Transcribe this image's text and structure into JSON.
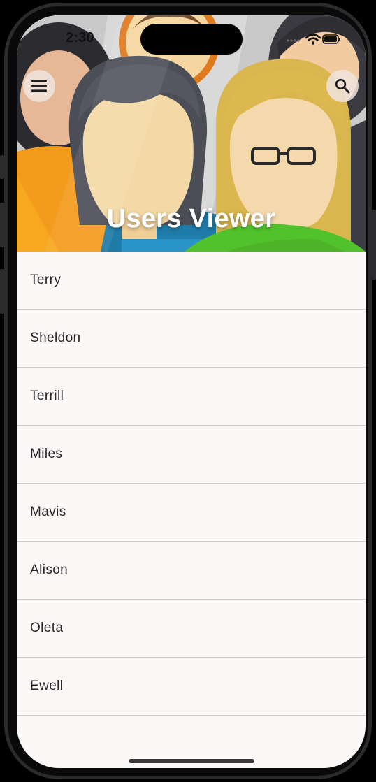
{
  "status_bar": {
    "time": "2:30"
  },
  "app_bar": {
    "title": "Users Viewer",
    "menu_icon": "hamburger-menu-icon",
    "search_icon": "search-icon"
  },
  "users": [
    {
      "name": "Terry"
    },
    {
      "name": "Sheldon"
    },
    {
      "name": "Terrill"
    },
    {
      "name": "Miles"
    },
    {
      "name": "Mavis"
    },
    {
      "name": "Alison"
    },
    {
      "name": "Oleta"
    },
    {
      "name": "Ewell"
    }
  ],
  "colors": {
    "list_background": "#fdf8f8",
    "divider": "#cfcacb",
    "title_text": "#ffffff",
    "button_background": "#f0e4de"
  }
}
